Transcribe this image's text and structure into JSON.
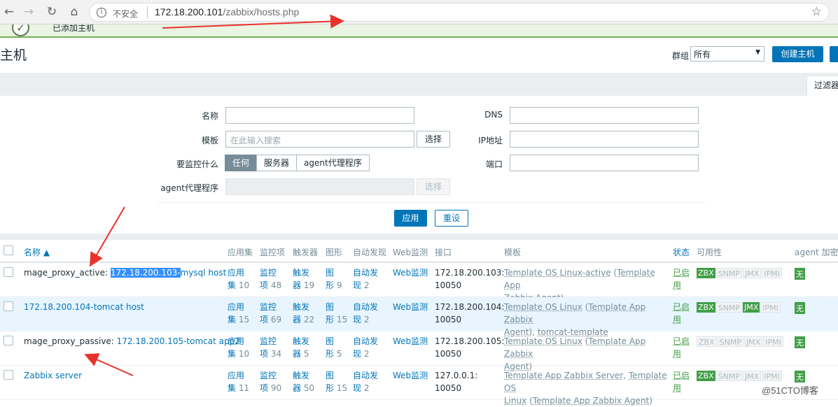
{
  "browser": {
    "insecure_label": "不安全",
    "url_host": "172.18.200.101",
    "url_path": "/zabbix/hosts.php"
  },
  "message": {
    "text": "已添加主机"
  },
  "header": {
    "title": "主机",
    "group_label": "群组",
    "group_value": "所有",
    "create_button": "创建主机"
  },
  "filter": {
    "tab_label": "过滤器",
    "name_label": "名称",
    "template_label": "模板",
    "template_placeholder": "在此输入搜索",
    "select_button": "选择",
    "monitor_label": "要监控什么",
    "monitor_options": [
      "任何",
      "服务器",
      "agent代理程序"
    ],
    "proxy_label": "agent代理程序",
    "proxy_select_button": "选择",
    "dns_label": "DNS",
    "ip_label": "IP地址",
    "port_label": "端口",
    "apply_button": "应用",
    "reset_button": "重设"
  },
  "table": {
    "headers": {
      "name": "名称 ▲",
      "apps": "应用集",
      "items": "监控项",
      "triggers": "触发器",
      "graphs": "图形",
      "discovery": "自动发现",
      "web": "Web监测",
      "interface": "接口",
      "templates": "模板",
      "status": "状态",
      "availability": "可用性",
      "agent_encryption": "agent 加密"
    },
    "rows": [
      {
        "name_prefix": "mage_proxy_active: ",
        "name_selected": "172.18.200.103-",
        "name_suffix": "mysql host",
        "apps_a": "应用",
        "apps_b": "集",
        "apps_n": "10",
        "items_a": "监控",
        "items_b": "项",
        "items_n": "48",
        "trig_a": "触发",
        "trig_b": "器",
        "trig_n": "19",
        "graph_a": "图",
        "graph_b": "形",
        "graph_n": "9",
        "disc_a": "自动发",
        "disc_b": "现",
        "disc_n": "2",
        "web": "Web监测",
        "iface_a": "172.18.200.103:",
        "iface_b": "10050",
        "tpl_1": "Template OS Linux-active",
        "tpl_2": " (",
        "tpl_3": "Template App",
        "tpl_4": "Zabbix Agent",
        "tpl_5": ")",
        "status_a": "已启",
        "status_b": "用",
        "avail": [
          "ZBX",
          "SNMP",
          "JMX",
          "IPMI"
        ],
        "avail_on": [
          true,
          false,
          false,
          false
        ],
        "enc": "无"
      },
      {
        "name_prefix": "",
        "name_selected": "",
        "name_suffix": "172.18.200.104-tomcat host",
        "apps_a": "应用",
        "apps_b": "集",
        "apps_n": "15",
        "items_a": "监控",
        "items_b": "项",
        "items_n": "69",
        "trig_a": "触发",
        "trig_b": "器",
        "trig_n": "22",
        "graph_a": "图",
        "graph_b": "形",
        "graph_n": "15",
        "disc_a": "自动发",
        "disc_b": "现",
        "disc_n": "2",
        "web": "Web监测",
        "iface_a": "172.18.200.104:",
        "iface_b": "10050",
        "tpl_1": "Template OS Linux",
        "tpl_2": " (",
        "tpl_3": "Template App Zabbix",
        "tpl_4": "Agent",
        "tpl_5": "), ",
        "tpl_6": "tomcat-template",
        "status_a": "已启",
        "status_b": "用",
        "avail": [
          "ZBX",
          "SNMP",
          "JMX",
          "IPMI"
        ],
        "avail_on": [
          true,
          false,
          true,
          false
        ],
        "enc": "无"
      },
      {
        "name_prefix": "mage_proxy_passive: ",
        "name_selected": "",
        "name_suffix": "172.18.200.105-tomcat app2",
        "apps_a": "应用",
        "apps_b": "集",
        "apps_n": "10",
        "items_a": "监控",
        "items_b": "项",
        "items_n": "34",
        "trig_a": "触发",
        "trig_b": "器",
        "trig_n": "5",
        "graph_a": "图",
        "graph_b": "形",
        "graph_n": "5",
        "disc_a": "自动发",
        "disc_b": "现",
        "disc_n": "2",
        "web": "Web监测",
        "iface_a": "172.18.200.105:",
        "iface_b": "10050",
        "tpl_1": "Template OS Linux",
        "tpl_2": " (",
        "tpl_3": "Template App Zabbix",
        "tpl_4": "Agent",
        "tpl_5": ")",
        "status_a": "已启",
        "status_b": "用",
        "avail": [
          "ZBX",
          "SNMP",
          "JMX",
          "IPMI"
        ],
        "avail_on": [
          false,
          false,
          false,
          false
        ],
        "enc": "无"
      },
      {
        "name_prefix": "",
        "name_selected": "",
        "name_suffix": "Zabbix server",
        "apps_a": "应用",
        "apps_b": "集",
        "apps_n": "11",
        "items_a": "监控",
        "items_b": "项",
        "items_n": "90",
        "trig_a": "触发",
        "trig_b": "器",
        "trig_n": "50",
        "graph_a": "图",
        "graph_b": "形",
        "graph_n": "15",
        "disc_a": "自动发",
        "disc_b": "现",
        "disc_n": "2",
        "web": "Web监测",
        "iface_a": "127.0.0.1:",
        "iface_b": "10050",
        "tpl_1": "Template App Zabbix Server",
        "tpl_2": ", ",
        "tpl_3": "Template OS",
        "tpl_4": "Linux",
        "tpl_5": " (",
        "tpl_6": "Template App Zabbix Agent",
        "tpl_7": ")",
        "status_a": "已启",
        "status_b": "用",
        "avail": [
          "ZBX",
          "SNMP",
          "JMX",
          "IPMI"
        ],
        "avail_on": [
          true,
          false,
          false,
          false
        ],
        "enc": "无"
      }
    ]
  },
  "watermark": "@51CTO博客",
  "colors": {
    "accent": "#0275b8",
    "enabled": "#429e47",
    "annotation": "#e8322b"
  }
}
